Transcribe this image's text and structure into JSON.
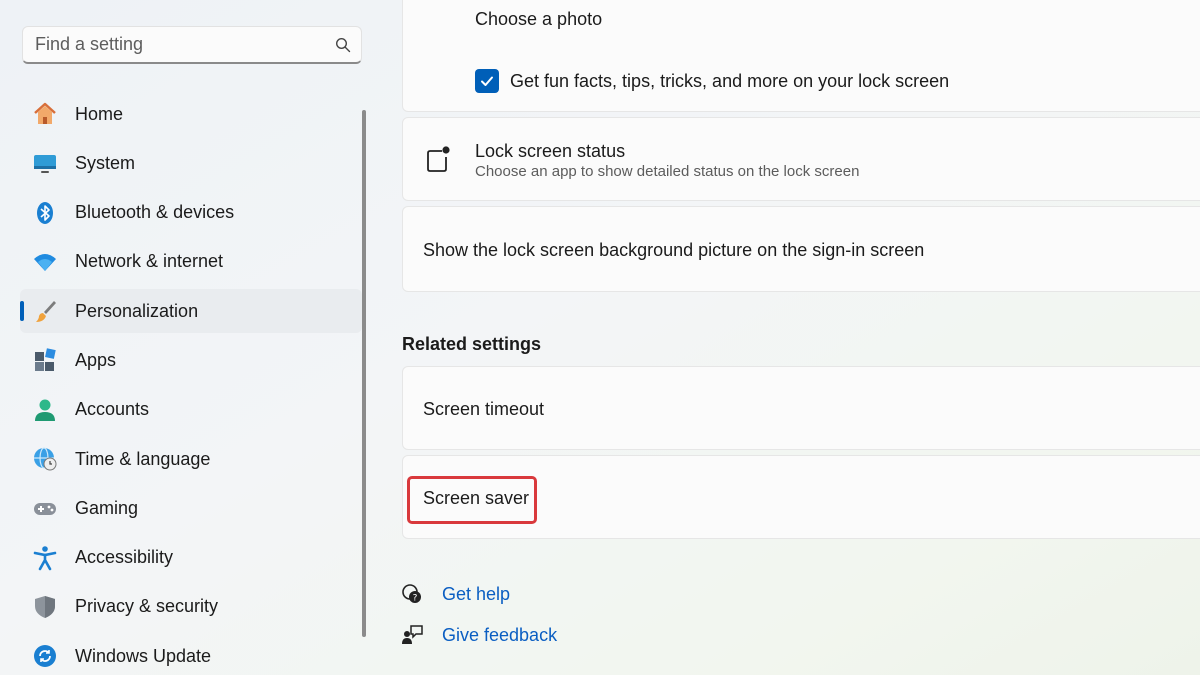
{
  "search": {
    "placeholder": "Find a setting",
    "icon": "search-icon"
  },
  "sidebar": {
    "items": [
      {
        "label": "Home",
        "icon": "home-icon",
        "selected": false
      },
      {
        "label": "System",
        "icon": "monitor-icon",
        "selected": false
      },
      {
        "label": "Bluetooth & devices",
        "icon": "bluetooth-icon",
        "selected": false
      },
      {
        "label": "Network & internet",
        "icon": "wifi-icon",
        "selected": false
      },
      {
        "label": "Personalization",
        "icon": "paintbrush-icon",
        "selected": true
      },
      {
        "label": "Apps",
        "icon": "apps-icon",
        "selected": false
      },
      {
        "label": "Accounts",
        "icon": "person-icon",
        "selected": false
      },
      {
        "label": "Time & language",
        "icon": "globe-clock-icon",
        "selected": false
      },
      {
        "label": "Gaming",
        "icon": "gamepad-icon",
        "selected": false
      },
      {
        "label": "Accessibility",
        "icon": "accessibility-icon",
        "selected": false
      },
      {
        "label": "Privacy & security",
        "icon": "shield-icon",
        "selected": false
      },
      {
        "label": "Windows Update",
        "icon": "update-icon",
        "selected": false
      }
    ]
  },
  "main": {
    "choose_photo": "Choose a photo",
    "fun_facts": {
      "label": "Get fun facts, tips, tricks, and more on your lock screen",
      "checked": true
    },
    "lock_status": {
      "title": "Lock screen status",
      "subtitle": "Choose an app to show detailed status on the lock screen"
    },
    "show_background": "Show the lock screen background picture on the sign-in screen",
    "related_heading": "Related settings",
    "screen_timeout": "Screen timeout",
    "screen_saver": "Screen saver",
    "get_help": "Get help",
    "give_feedback": "Give feedback"
  },
  "colors": {
    "accent": "#005fb8",
    "highlight_border": "#d9393c",
    "link": "#0a5ec2"
  }
}
